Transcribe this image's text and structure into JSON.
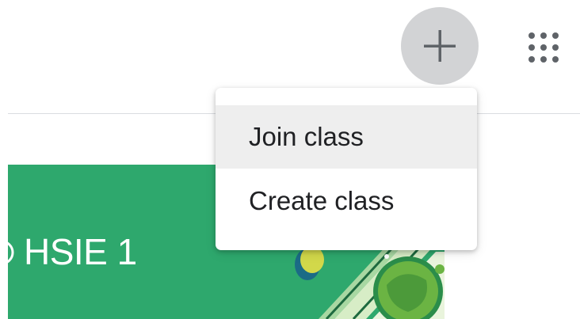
{
  "header": {
    "add_icon": "plus-icon",
    "apps_icon": "apps-grid-icon"
  },
  "menu": {
    "items": [
      {
        "label": "Join class"
      },
      {
        "label": "Create class"
      }
    ]
  },
  "class_card": {
    "title": "HSIE 1",
    "color": "#2ea86d"
  },
  "colors": {
    "add_button_bg": "#d2d3d5",
    "icon_gray": "#5f6368",
    "menu_hover": "#eeeeee",
    "divider": "#dadce0"
  }
}
